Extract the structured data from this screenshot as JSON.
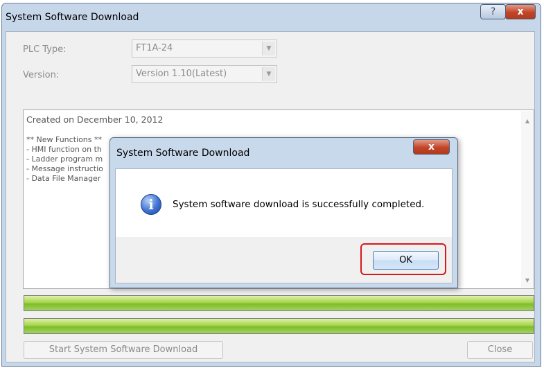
{
  "main_window": {
    "title": "System Software Download",
    "help_glyph": "?",
    "close_glyph": "x",
    "plc_type_label": "PLC Type:",
    "plc_type_value": "FT1A-24",
    "version_label": "Version:",
    "version_value": "Version 1.10(Latest)",
    "release_notes": {
      "lines": [
        "Created on December 10, 2012",
        "** New Functions **",
        "- HMI function on th",
        "- Ladder program m",
        "- Message instructio",
        "- Data File Manager"
      ]
    },
    "progress_bars": [
      {
        "value_percent": 100
      },
      {
        "value_percent": 100
      }
    ],
    "start_button_label": "Start System Software Download",
    "close_button_label": "Close"
  },
  "dialog": {
    "title": "System Software Download",
    "close_glyph": "x",
    "message": "System software download is successfully completed.",
    "ok_label": "OK"
  },
  "icons": {
    "info": "info-icon",
    "dropdown_arrow": "chevron-down-icon",
    "scroll_up": "scroll-up-icon",
    "scroll_down": "scroll-down-icon"
  },
  "colors": {
    "progress_green": "#8cc63f",
    "highlight_red": "#d6181b",
    "title_bar": "#c7d7ea"
  }
}
